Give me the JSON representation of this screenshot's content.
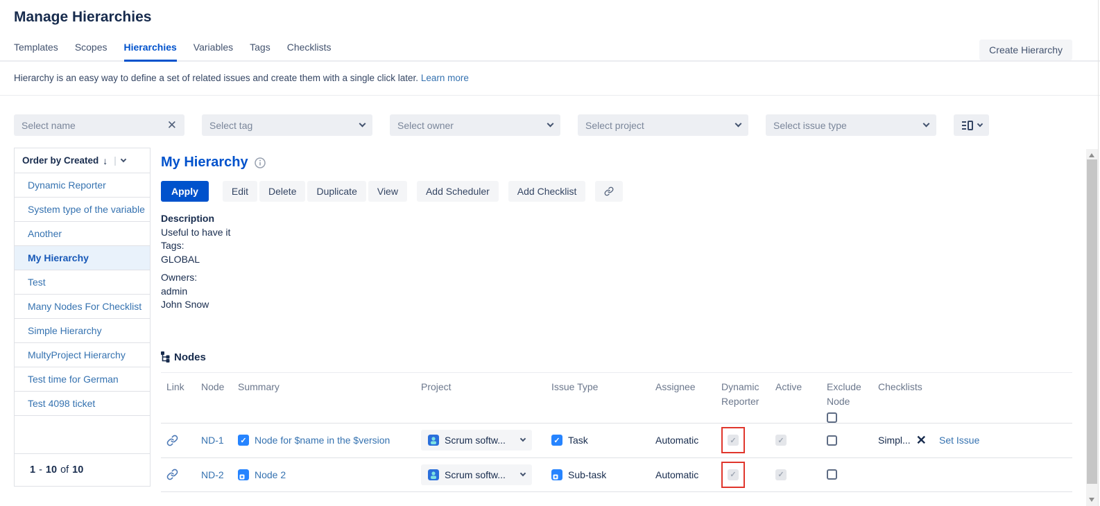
{
  "header": {
    "title": "Manage Hierarchies",
    "create_button": "Create Hierarchy"
  },
  "tabs": [
    {
      "label": "Templates"
    },
    {
      "label": "Scopes"
    },
    {
      "label": "Hierarchies"
    },
    {
      "label": "Variables"
    },
    {
      "label": "Tags"
    },
    {
      "label": "Checklists"
    }
  ],
  "active_tab": "Hierarchies",
  "intro": {
    "text": "Hierarchy is an easy way to define a set of related issues and create them with a single click later.",
    "link_label": "Learn more"
  },
  "filters": {
    "name_placeholder": "Select name",
    "tag_placeholder": "Select tag",
    "owner_placeholder": "Select owner",
    "project_placeholder": "Select project",
    "issue_type_placeholder": "Select issue type"
  },
  "sidebar": {
    "order_by_label": "Order by Created",
    "order_arrow": "↓",
    "items": [
      "Dynamic Reporter",
      "System type of the variable",
      "Another",
      "My Hierarchy",
      "Test",
      "Many Nodes For Checklist",
      "Simple Hierarchy",
      "MultyProject Hierarchy",
      "Test time for German",
      "Test 4098 ticket"
    ],
    "selected_item": "My Hierarchy",
    "pagination": {
      "from": "1",
      "dash": "-",
      "to": "10",
      "of": "of",
      "total": "10"
    }
  },
  "detail": {
    "title": "My Hierarchy",
    "toolbar": {
      "apply": "Apply",
      "edit": "Edit",
      "delete": "Delete",
      "duplicate": "Duplicate",
      "view": "View",
      "add_scheduler": "Add Scheduler",
      "add_checklist": "Add Checklist"
    },
    "description_label": "Description",
    "description": "Useful to have it",
    "tags_label": "Tags:",
    "tags_value": "GLOBAL",
    "owners_label": "Owners:",
    "owners": [
      "admin",
      "John Snow"
    ]
  },
  "nodes": {
    "section_title": "Nodes",
    "columns": {
      "link": "Link",
      "node": "Node",
      "summary": "Summary",
      "project": "Project",
      "issue_type": "Issue Type",
      "assignee": "Assignee",
      "dynamic_reporter": "Dynamic Reporter",
      "active": "Active",
      "exclude_node": "Exclude Node",
      "checklists": "Checklists"
    },
    "rows": [
      {
        "node": "ND-1",
        "summary": "Node for $name in the $version",
        "project": "Scrum softw...",
        "issue_type": "Task",
        "assignee": "Automatic",
        "checklist": "Simpl...",
        "set_issue": "Set Issue"
      },
      {
        "node": "ND-2",
        "summary": "Node 2",
        "project": "Scrum softw...",
        "issue_type": "Sub-task",
        "assignee": "Automatic"
      }
    ]
  },
  "icons": {
    "checkmark": "✓",
    "clear": "×",
    "close": "×"
  },
  "colors": {
    "accent": "#0052CC",
    "link": "#3572B0",
    "annotation_red": "#E0352B",
    "checkbox_blue": "#2684FF",
    "tab_underline": "#0052CC"
  }
}
